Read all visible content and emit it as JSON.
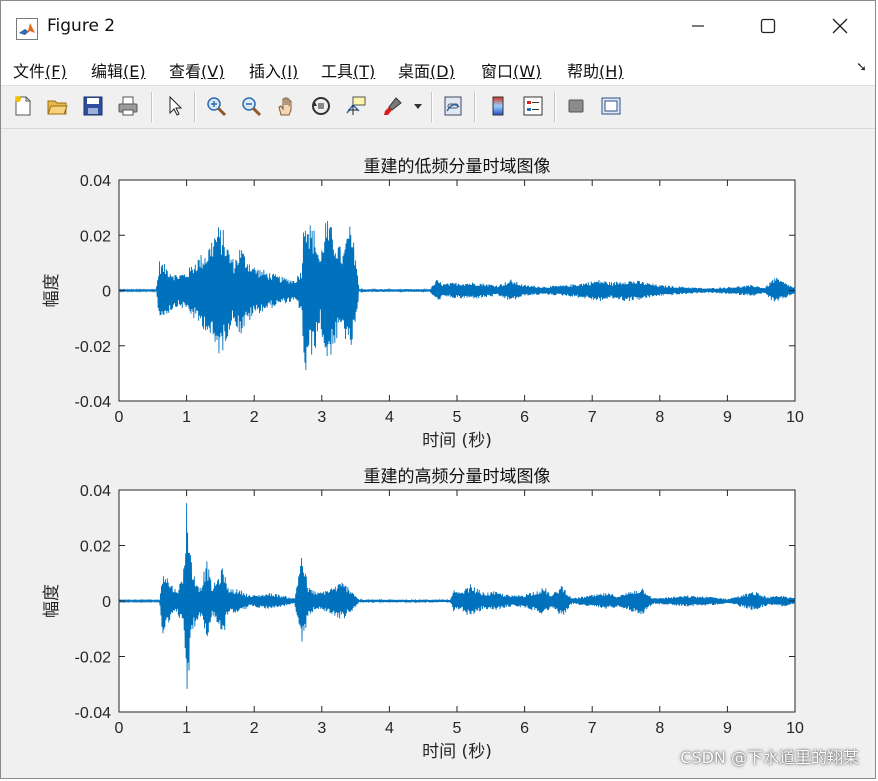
{
  "window": {
    "title": "Figure 2"
  },
  "menu": [
    {
      "label": "文件",
      "mnemonic": "(F)"
    },
    {
      "label": "编辑",
      "mnemonic": "(E)"
    },
    {
      "label": "查看",
      "mnemonic": "(V)"
    },
    {
      "label": "插入",
      "mnemonic": "(I)"
    },
    {
      "label": "工具",
      "mnemonic": "(T)"
    },
    {
      "label": "桌面",
      "mnemonic": "(D)"
    },
    {
      "label": "窗口",
      "mnemonic": "(W)"
    },
    {
      "label": "帮助",
      "mnemonic": "(H)"
    }
  ],
  "toolbar": [
    {
      "name": "new-figure-icon"
    },
    {
      "name": "open-file-icon"
    },
    {
      "name": "save-icon"
    },
    {
      "name": "print-icon"
    },
    {
      "name": "edit-plot-arrow-icon"
    },
    {
      "name": "zoom-in-icon"
    },
    {
      "name": "zoom-out-icon"
    },
    {
      "name": "pan-hand-icon"
    },
    {
      "name": "rotate-3d-icon"
    },
    {
      "name": "data-cursor-icon"
    },
    {
      "name": "brush-icon"
    },
    {
      "name": "brush-dropdown-icon"
    },
    {
      "name": "link-plot-icon"
    },
    {
      "name": "colorbar-icon"
    },
    {
      "name": "legend-icon"
    },
    {
      "name": "hide-plot-tools-icon"
    },
    {
      "name": "show-plot-tools-icon"
    }
  ],
  "colors": {
    "series": "#0072bd",
    "axes_bg": "#ffffff",
    "figure_bg": "#f0f0f0"
  },
  "chart_data": [
    {
      "type": "line",
      "title": "重建的低频分量时域图像",
      "xlabel": "时间 (秒)",
      "ylabel": "幅度",
      "xlim": [
        0,
        10
      ],
      "ylim": [
        -0.04,
        0.04
      ],
      "xticks": [
        "0",
        "1",
        "2",
        "3",
        "4",
        "5",
        "6",
        "7",
        "8",
        "9",
        "10"
      ],
      "yticks": [
        "0.04",
        "0.02",
        "0",
        "-0.02",
        "-0.04"
      ],
      "grid": false,
      "series": [
        {
          "envelope": [
            {
              "t": 0.0,
              "amp": 0.0003
            },
            {
              "t": 0.55,
              "amp": 0.0003
            },
            {
              "t": 0.6,
              "amp": 0.011
            },
            {
              "t": 0.75,
              "amp": 0.008
            },
            {
              "t": 0.85,
              "amp": 0.006
            },
            {
              "t": 1.0,
              "amp": 0.007
            },
            {
              "t": 1.15,
              "amp": 0.012
            },
            {
              "t": 1.3,
              "amp": 0.015
            },
            {
              "t": 1.45,
              "amp": 0.024
            },
            {
              "t": 1.55,
              "amp": 0.022
            },
            {
              "t": 1.6,
              "amp": 0.017
            },
            {
              "t": 1.7,
              "amp": 0.011
            },
            {
              "t": 1.8,
              "amp": 0.017
            },
            {
              "t": 1.85,
              "amp": 0.014
            },
            {
              "t": 2.0,
              "amp": 0.009
            },
            {
              "t": 2.2,
              "amp": 0.007
            },
            {
              "t": 2.4,
              "amp": 0.005
            },
            {
              "t": 2.6,
              "amp": 0.004
            },
            {
              "t": 2.7,
              "amp": 0.008
            },
            {
              "t": 2.75,
              "amp": 0.034
            },
            {
              "t": 2.82,
              "amp": 0.025
            },
            {
              "t": 2.9,
              "amp": 0.022
            },
            {
              "t": 2.98,
              "amp": 0.012
            },
            {
              "t": 3.05,
              "amp": 0.027
            },
            {
              "t": 3.15,
              "amp": 0.023
            },
            {
              "t": 3.25,
              "amp": 0.017
            },
            {
              "t": 3.32,
              "amp": 0.014
            },
            {
              "t": 3.4,
              "amp": 0.025
            },
            {
              "t": 3.5,
              "amp": 0.015
            },
            {
              "t": 3.55,
              "amp": 0.0005
            },
            {
              "t": 4.6,
              "amp": 0.0005
            },
            {
              "t": 4.7,
              "amp": 0.004
            },
            {
              "t": 4.8,
              "amp": 0.0025
            },
            {
              "t": 5.0,
              "amp": 0.003
            },
            {
              "t": 5.3,
              "amp": 0.003
            },
            {
              "t": 5.6,
              "amp": 0.002
            },
            {
              "t": 5.8,
              "amp": 0.004
            },
            {
              "t": 6.0,
              "amp": 0.002
            },
            {
              "t": 6.3,
              "amp": 0.0015
            },
            {
              "t": 6.6,
              "amp": 0.002
            },
            {
              "t": 6.9,
              "amp": 0.003
            },
            {
              "t": 7.1,
              "amp": 0.004
            },
            {
              "t": 7.3,
              "amp": 0.003
            },
            {
              "t": 7.5,
              "amp": 0.004
            },
            {
              "t": 7.7,
              "amp": 0.0035
            },
            {
              "t": 8.0,
              "amp": 0.002
            },
            {
              "t": 8.3,
              "amp": 0.0015
            },
            {
              "t": 8.7,
              "amp": 0.0008
            },
            {
              "t": 9.4,
              "amp": 0.002
            },
            {
              "t": 9.55,
              "amp": 0.001
            },
            {
              "t": 9.7,
              "amp": 0.005
            },
            {
              "t": 9.85,
              "amp": 0.003
            },
            {
              "t": 10.0,
              "amp": 0.001
            }
          ]
        }
      ]
    },
    {
      "type": "line",
      "title": "重建的高频分量时域图像",
      "xlabel": "时间 (秒)",
      "ylabel": "幅度",
      "xlim": [
        0,
        10
      ],
      "ylim": [
        -0.04,
        0.04
      ],
      "xticks": [
        "0",
        "1",
        "2",
        "3",
        "4",
        "5",
        "6",
        "7",
        "8",
        "9",
        "10"
      ],
      "yticks": [
        "0.04",
        "0.02",
        "0",
        "-0.02",
        "-0.04"
      ],
      "grid": false,
      "series": [
        {
          "envelope": [
            {
              "t": 0.0,
              "amp": 0.0003
            },
            {
              "t": 0.6,
              "amp": 0.0003
            },
            {
              "t": 0.65,
              "amp": 0.013
            },
            {
              "t": 0.75,
              "amp": 0.007
            },
            {
              "t": 0.85,
              "amp": 0.004
            },
            {
              "t": 0.95,
              "amp": 0.009
            },
            {
              "t": 1.0,
              "amp": 0.038
            },
            {
              "t": 1.08,
              "amp": 0.012
            },
            {
              "t": 1.2,
              "amp": 0.005
            },
            {
              "t": 1.3,
              "amp": 0.015
            },
            {
              "t": 1.38,
              "amp": 0.005
            },
            {
              "t": 1.55,
              "amp": 0.013
            },
            {
              "t": 1.6,
              "amp": 0.005
            },
            {
              "t": 1.8,
              "amp": 0.004
            },
            {
              "t": 1.95,
              "amp": 0.002
            },
            {
              "t": 2.25,
              "amp": 0.003
            },
            {
              "t": 2.6,
              "amp": 0.001
            },
            {
              "t": 2.7,
              "amp": 0.019
            },
            {
              "t": 2.8,
              "amp": 0.005
            },
            {
              "t": 2.95,
              "amp": 0.003
            },
            {
              "t": 3.15,
              "amp": 0.005
            },
            {
              "t": 3.3,
              "amp": 0.007
            },
            {
              "t": 3.45,
              "amp": 0.004
            },
            {
              "t": 3.55,
              "amp": 0.0005
            },
            {
              "t": 4.9,
              "amp": 0.0005
            },
            {
              "t": 4.95,
              "amp": 0.004
            },
            {
              "t": 5.05,
              "amp": 0.003
            },
            {
              "t": 5.2,
              "amp": 0.006
            },
            {
              "t": 5.4,
              "amp": 0.003
            },
            {
              "t": 5.55,
              "amp": 0.0035
            },
            {
              "t": 5.8,
              "amp": 0.002
            },
            {
              "t": 6.0,
              "amp": 0.0025
            },
            {
              "t": 6.3,
              "amp": 0.005
            },
            {
              "t": 6.4,
              "amp": 0.002
            },
            {
              "t": 6.55,
              "amp": 0.006
            },
            {
              "t": 6.7,
              "amp": 0.001
            },
            {
              "t": 7.2,
              "amp": 0.003
            },
            {
              "t": 7.4,
              "amp": 0.002
            },
            {
              "t": 7.6,
              "amp": 0.004
            },
            {
              "t": 7.75,
              "amp": 0.005
            },
            {
              "t": 7.9,
              "amp": 0.001
            },
            {
              "t": 8.4,
              "amp": 0.002
            },
            {
              "t": 8.8,
              "amp": 0.0015
            },
            {
              "t": 9.0,
              "amp": 0.0008
            },
            {
              "t": 9.4,
              "amp": 0.0035
            },
            {
              "t": 9.6,
              "amp": 0.0015
            },
            {
              "t": 9.85,
              "amp": 0.002
            },
            {
              "t": 10.0,
              "amp": 0.001
            }
          ]
        }
      ]
    }
  ],
  "watermark": "CSDN @下水道里的翔某"
}
